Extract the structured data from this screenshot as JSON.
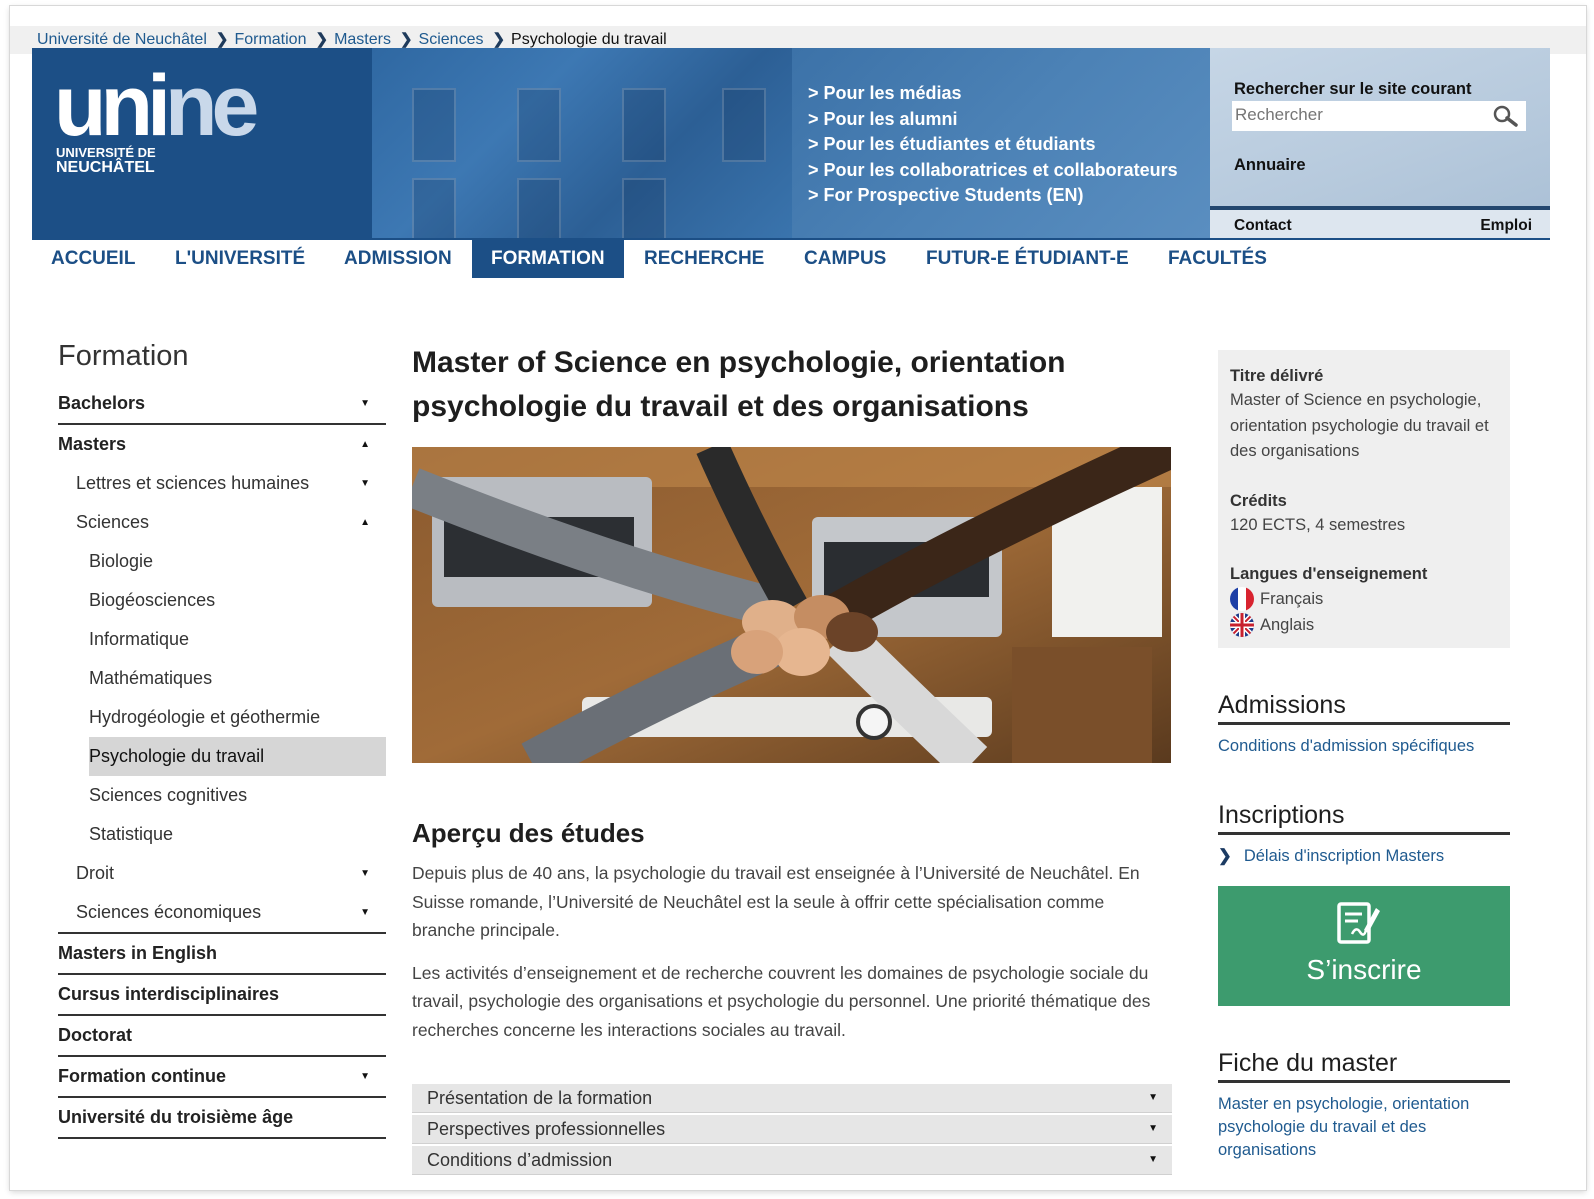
{
  "breadcrumb": [
    "Université de Neuchâtel",
    "Formation",
    "Masters",
    "Sciences"
  ],
  "breadcrumb_current": "Psychologie du travail",
  "logo": {
    "word_a": "uni",
    "word_b": "ne",
    "sub1": "UNIVERSITÉ DE",
    "sub2": "NEUCHÂTEL"
  },
  "header_links": [
    "> Pour les médias",
    "> Pour les alumni",
    "> Pour les étudiantes et étudiants",
    "> Pour les collaboratrices et collaborateurs",
    "> For Prospective Students (EN)"
  ],
  "search": {
    "title": "Rechercher sur le site courant",
    "placeholder": "Rechercher"
  },
  "annuaire": "Annuaire",
  "contact": "Contact",
  "emploi": "Emploi",
  "nav": [
    "ACCUEIL",
    "L'UNIVERSITÉ",
    "ADMISSION",
    "FORMATION",
    "RECHERCHE",
    "CAMPUS",
    "FUTUR-E ÉTUDIANT-E",
    "FACULTÉS"
  ],
  "nav_active": "FORMATION",
  "sidebar": {
    "title": "Formation",
    "items": [
      {
        "label": "Bachelors",
        "caret": "▼"
      },
      {
        "label": "Masters",
        "caret": "▲"
      },
      {
        "label": "Lettres et sciences humaines",
        "caret": "▼"
      },
      {
        "label": "Sciences",
        "caret": "▲"
      },
      {
        "label": "Biologie"
      },
      {
        "label": "Biogéosciences"
      },
      {
        "label": "Informatique"
      },
      {
        "label": "Mathématiques"
      },
      {
        "label": "Hydrogéologie et géothermie"
      },
      {
        "label": "Psychologie du travail"
      },
      {
        "label": "Sciences cognitives"
      },
      {
        "label": "Statistique"
      },
      {
        "label": "Droit",
        "caret": "▼"
      },
      {
        "label": "Sciences économiques",
        "caret": "▼"
      },
      {
        "label": "Masters in English"
      },
      {
        "label": "Cursus interdisciplinaires"
      },
      {
        "label": "Doctorat"
      },
      {
        "label": "Formation continue",
        "caret": "▼"
      },
      {
        "label": "Université du troisième âge"
      }
    ]
  },
  "content": {
    "title_line1": "Master of Science en psychologie, orientation",
    "title_line2": "psychologie du travail et des organisations",
    "section": "Aperçu des études",
    "para1": "Depuis plus de 40 ans, la psychologie du travail est enseignée à l’Université de Neuchâtel. En Suisse romande, l’Université de Neuchâtel est la seule à offrir cette spécialisation comme branche principale.",
    "para2": "Les activités d’enseignement et de recherche couvrent les domaines de psychologie sociale du travail, psychologie des organisations et psychologie du personnel. Une priorité thématique des recherches concerne les interactions sociales au travail.",
    "accordion": [
      "Présentation de la formation",
      "Perspectives professionnelles",
      "Conditions d’admission"
    ]
  },
  "right": {
    "titre_label": "Titre délivré",
    "titre_value": "Master of Science en psychologie, orientation psychologie du travail et des organisations",
    "credits_label": "Crédits",
    "credits_value": "120 ECTS, 4 semestres",
    "langues_label": "Langues d'enseignement",
    "langues": [
      "Français",
      "Anglais"
    ],
    "admissions_h": "Admissions",
    "admissions_link": "Conditions d'admission spécifiques",
    "inscriptions_h": "Inscriptions",
    "inscriptions_link": "Délais d'inscription Masters",
    "inscrire_label": "S’inscrire",
    "fiche_h": "Fiche du master",
    "fiche_link": "Master en psychologie, orientation psychologie du travail et des organisations"
  },
  "colors": {
    "brand_blue": "#1c4f86",
    "link_blue": "#1f5a8f",
    "inscrire_green": "#3d9b6e"
  }
}
